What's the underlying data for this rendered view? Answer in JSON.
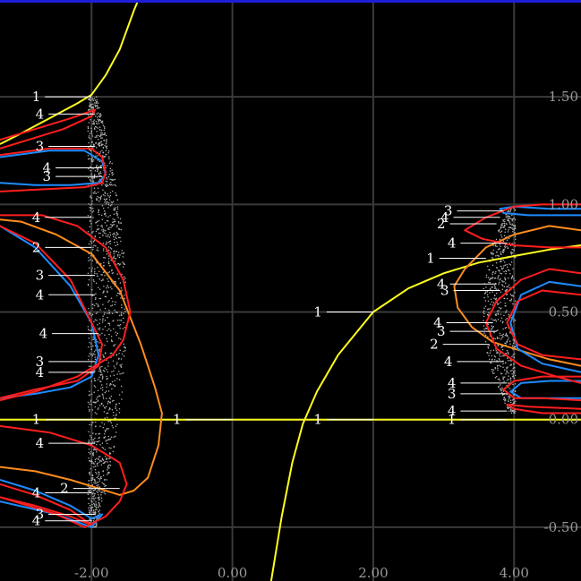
{
  "colors": {
    "background": "#000000",
    "grid": "#3a3a3a",
    "gray_region": "#b4b4b4",
    "c1": "#ffff1e",
    "c2": "#ff8c1e",
    "c3": "#1e8cff",
    "c4": "#ff1e1e",
    "top_border": "#1e1ed8"
  },
  "chart_data": {
    "type": "line",
    "title": "",
    "xlabel": "",
    "ylabel": "",
    "xlim": [
      -3.3,
      4.95
    ],
    "ylim": [
      -0.75,
      1.95
    ],
    "grid": true,
    "x_ticks": [
      {
        "value": -2,
        "label": "-2.00"
      },
      {
        "value": 0,
        "label": "0.00"
      },
      {
        "value": 2,
        "label": "2.00"
      },
      {
        "value": 4,
        "label": "4.00"
      }
    ],
    "y_ticks": [
      {
        "value": -0.5,
        "label": "-0.50"
      },
      {
        "value": 0,
        "label": "0.00"
      },
      {
        "value": 0.5,
        "label": "0.50"
      },
      {
        "value": 1,
        "label": "1.00"
      },
      {
        "value": 1.5,
        "label": "1.50"
      }
    ],
    "series": [
      {
        "period": "1",
        "color": "#ffff1e",
        "segments": [
          [
            [
              -3.3,
              1.28
            ],
            [
              -3.0,
              1.33
            ],
            [
              -2.6,
              1.4
            ],
            [
              -2.2,
              1.47
            ],
            [
              -2.0,
              1.51
            ],
            [
              -1.8,
              1.6
            ],
            [
              -1.6,
              1.72
            ],
            [
              -1.4,
              1.9
            ],
            [
              -1.3,
              1.98
            ]
          ],
          [
            [
              -3.3,
              0.0
            ],
            [
              4.95,
              0.0
            ]
          ],
          [
            [
              0.55,
              -0.75
            ],
            [
              0.7,
              -0.45
            ],
            [
              0.85,
              -0.2
            ],
            [
              1.0,
              -0.02
            ],
            [
              1.2,
              0.13
            ],
            [
              1.5,
              0.3
            ],
            [
              2.0,
              0.5
            ],
            [
              2.5,
              0.61
            ],
            [
              3.0,
              0.68
            ],
            [
              3.5,
              0.73
            ],
            [
              4.0,
              0.76
            ],
            [
              4.5,
              0.79
            ],
            [
              4.95,
              0.81
            ]
          ]
        ]
      },
      {
        "period": "2",
        "color": "#ff8c1e",
        "segments": [
          [
            [
              -3.3,
              0.93
            ],
            [
              -3.0,
              0.92
            ],
            [
              -2.5,
              0.86
            ],
            [
              -2.0,
              0.77
            ],
            [
              -1.6,
              0.6
            ],
            [
              -1.3,
              0.35
            ],
            [
              -1.1,
              0.15
            ],
            [
              -1.0,
              0.03
            ],
            [
              -1.05,
              -0.12
            ],
            [
              -1.2,
              -0.27
            ],
            [
              -1.4,
              -0.33
            ],
            [
              -1.6,
              -0.35
            ],
            [
              -1.9,
              -0.32
            ],
            [
              -2.3,
              -0.28
            ],
            [
              -2.8,
              -0.24
            ],
            [
              -3.3,
              -0.22
            ]
          ],
          [
            [
              4.95,
              0.88
            ],
            [
              4.5,
              0.9
            ],
            [
              4.0,
              0.86
            ],
            [
              3.6,
              0.8
            ],
            [
              3.3,
              0.7
            ],
            [
              3.15,
              0.62
            ],
            [
              3.2,
              0.52
            ],
            [
              3.4,
              0.43
            ],
            [
              3.7,
              0.36
            ],
            [
              4.0,
              0.33
            ],
            [
              4.5,
              0.28
            ],
            [
              4.95,
              0.25
            ]
          ]
        ]
      },
      {
        "period": "3",
        "color": "#1e8cff",
        "segments": [
          [
            [
              -3.3,
              1.22
            ],
            [
              -2.6,
              1.25
            ],
            [
              -2.1,
              1.25
            ],
            [
              -1.85,
              1.2
            ],
            [
              -1.8,
              1.14
            ],
            [
              -1.9,
              1.1
            ],
            [
              -2.3,
              1.09
            ],
            [
              -2.8,
              1.09
            ],
            [
              -3.3,
              1.1
            ]
          ],
          [
            [
              -3.3,
              0.9
            ],
            [
              -2.8,
              0.8
            ],
            [
              -2.3,
              0.62
            ],
            [
              -2.0,
              0.45
            ],
            [
              -1.9,
              0.3
            ],
            [
              -2.0,
              0.2
            ],
            [
              -2.3,
              0.15
            ],
            [
              -2.8,
              0.12
            ],
            [
              -3.3,
              0.1
            ]
          ],
          [
            [
              -3.3,
              -0.28
            ],
            [
              -2.8,
              -0.33
            ],
            [
              -2.3,
              -0.4
            ],
            [
              -2.0,
              -0.46
            ],
            [
              -1.85,
              -0.44
            ],
            [
              -2.0,
              -0.5
            ],
            [
              -2.5,
              -0.44
            ],
            [
              -3.3,
              -0.38
            ]
          ],
          [
            [
              4.95,
              0.98
            ],
            [
              4.5,
              0.98
            ],
            [
              4.0,
              0.99
            ],
            [
              3.8,
              0.98
            ],
            [
              3.85,
              0.96
            ],
            [
              4.2,
              0.95
            ],
            [
              4.95,
              0.95
            ]
          ],
          [
            [
              4.95,
              0.62
            ],
            [
              4.5,
              0.64
            ],
            [
              4.1,
              0.58
            ],
            [
              3.95,
              0.45
            ],
            [
              4.05,
              0.33
            ],
            [
              4.4,
              0.26
            ],
            [
              4.95,
              0.22
            ]
          ],
          [
            [
              4.95,
              0.18
            ],
            [
              4.5,
              0.18
            ],
            [
              4.1,
              0.17
            ],
            [
              3.95,
              0.13
            ],
            [
              4.1,
              0.1
            ],
            [
              4.5,
              0.1
            ],
            [
              4.95,
              0.1
            ]
          ]
        ]
      },
      {
        "period": "4",
        "color": "#ff1e1e",
        "segments": [
          [
            [
              -3.3,
              1.3
            ],
            [
              -2.8,
              1.35
            ],
            [
              -2.3,
              1.4
            ],
            [
              -1.95,
              1.44
            ],
            [
              -2.0,
              1.41
            ],
            [
              -2.4,
              1.35
            ],
            [
              -2.9,
              1.3
            ],
            [
              -3.3,
              1.26
            ]
          ],
          [
            [
              -3.3,
              1.23
            ],
            [
              -2.6,
              1.26
            ],
            [
              -2.0,
              1.26
            ],
            [
              -1.85,
              1.22
            ],
            [
              -1.8,
              1.15
            ],
            [
              -1.85,
              1.1
            ],
            [
              -2.1,
              1.08
            ],
            [
              -2.7,
              1.07
            ],
            [
              -3.3,
              1.06
            ]
          ],
          [
            [
              -3.3,
              0.95
            ],
            [
              -2.7,
              0.95
            ],
            [
              -2.2,
              0.9
            ],
            [
              -1.8,
              0.8
            ],
            [
              -1.55,
              0.65
            ],
            [
              -1.45,
              0.5
            ],
            [
              -1.55,
              0.37
            ],
            [
              -1.7,
              0.3
            ],
            [
              -2.2,
              0.2
            ],
            [
              -2.8,
              0.13
            ],
            [
              -3.3,
              0.09
            ]
          ],
          [
            [
              -3.3,
              0.9
            ],
            [
              -2.8,
              0.82
            ],
            [
              -2.3,
              0.65
            ],
            [
              -2.0,
              0.45
            ],
            [
              -1.85,
              0.35
            ],
            [
              -1.9,
              0.25
            ],
            [
              -2.2,
              0.18
            ],
            [
              -2.8,
              0.14
            ],
            [
              -3.3,
              0.1
            ]
          ],
          [
            [
              -3.3,
              -0.03
            ],
            [
              -2.6,
              -0.06
            ],
            [
              -2.0,
              -0.12
            ],
            [
              -1.6,
              -0.2
            ],
            [
              -1.5,
              -0.3
            ],
            [
              -1.6,
              -0.38
            ],
            [
              -1.8,
              -0.45
            ],
            [
              -2.1,
              -0.5
            ],
            [
              -2.5,
              -0.44
            ],
            [
              -2.9,
              -0.4
            ],
            [
              -3.3,
              -0.36
            ]
          ],
          [
            [
              -3.3,
              -0.3
            ],
            [
              -2.8,
              -0.35
            ],
            [
              -2.3,
              -0.42
            ],
            [
              -2.0,
              -0.49
            ],
            [
              -2.3,
              -0.45
            ],
            [
              -2.8,
              -0.4
            ],
            [
              -3.3,
              -0.36
            ]
          ],
          [
            [
              4.95,
              1.0
            ],
            [
              4.4,
              1.0
            ],
            [
              4.0,
              0.99
            ],
            [
              3.6,
              0.94
            ],
            [
              3.3,
              0.88
            ],
            [
              3.55,
              0.84
            ],
            [
              4.0,
              0.81
            ],
            [
              4.5,
              0.8
            ],
            [
              4.95,
              0.8
            ]
          ],
          [
            [
              4.95,
              0.68
            ],
            [
              4.5,
              0.7
            ],
            [
              4.1,
              0.65
            ],
            [
              3.75,
              0.55
            ],
            [
              3.6,
              0.45
            ],
            [
              3.75,
              0.33
            ],
            [
              4.1,
              0.25
            ],
            [
              4.6,
              0.2
            ],
            [
              4.95,
              0.17
            ]
          ],
          [
            [
              4.95,
              0.58
            ],
            [
              4.4,
              0.6
            ],
            [
              4.05,
              0.55
            ],
            [
              3.9,
              0.45
            ],
            [
              4.05,
              0.35
            ],
            [
              4.4,
              0.3
            ],
            [
              4.95,
              0.28
            ]
          ],
          [
            [
              4.95,
              0.2
            ],
            [
              4.4,
              0.2
            ],
            [
              4.0,
              0.18
            ],
            [
              3.85,
              0.14
            ],
            [
              4.0,
              0.1
            ],
            [
              4.4,
              0.1
            ],
            [
              4.95,
              0.09
            ]
          ],
          [
            [
              4.95,
              0.03
            ],
            [
              4.4,
              0.03
            ],
            [
              4.0,
              0.05
            ],
            [
              3.9,
              0.07
            ],
            [
              4.2,
              0.06
            ],
            [
              4.95,
              0.05
            ]
          ]
        ]
      }
    ],
    "chaotic_regions": [
      {
        "name": "left",
        "x_min": -2.05,
        "x_max": -1.5,
        "y_min": -0.5,
        "y_max": 1.5
      },
      {
        "name": "right",
        "x_min": 3.55,
        "x_max": 4.02,
        "y_min": 0.03,
        "y_max": 0.99
      }
    ],
    "annotations": [
      {
        "text": "1",
        "x": -2.0,
        "y": 1.5,
        "side": "left",
        "color": "#ffff1e"
      },
      {
        "text": "4",
        "x": -1.95,
        "y": 1.42,
        "side": "left",
        "color": "#ff1e1e"
      },
      {
        "text": "3",
        "x": -1.95,
        "y": 1.27,
        "side": "left",
        "color": "#1e8cff"
      },
      {
        "text": "4",
        "x": -1.85,
        "y": 1.17,
        "side": "left",
        "color": "#ff1e1e"
      },
      {
        "text": "3",
        "x": -1.85,
        "y": 1.13,
        "side": "left",
        "color": "#1e8cff"
      },
      {
        "text": "4",
        "x": -2.0,
        "y": 0.94,
        "side": "left",
        "color": "#ff1e1e"
      },
      {
        "text": "2",
        "x": -2.0,
        "y": 0.8,
        "side": "left",
        "color": "#ff8c1e"
      },
      {
        "text": "3",
        "x": -1.95,
        "y": 0.67,
        "side": "left",
        "color": "#1e8cff"
      },
      {
        "text": "4",
        "x": -1.95,
        "y": 0.58,
        "side": "left",
        "color": "#ff1e1e"
      },
      {
        "text": "4",
        "x": -1.9,
        "y": 0.4,
        "side": "left",
        "color": "#ff1e1e"
      },
      {
        "text": "3",
        "x": -1.95,
        "y": 0.27,
        "side": "left",
        "color": "#1e8cff"
      },
      {
        "text": "4",
        "x": -1.95,
        "y": 0.22,
        "side": "left",
        "color": "#ff1e1e"
      },
      {
        "text": "1",
        "x": -2.0,
        "y": 0.0,
        "side": "left",
        "color": "#ffff1e"
      },
      {
        "text": "1",
        "x": 0.0,
        "y": 0.0,
        "side": "left",
        "color": "#ffff1e"
      },
      {
        "text": "1",
        "x": 2.0,
        "y": 0.0,
        "side": "left",
        "color": "#ffff1e"
      },
      {
        "text": "4",
        "x": -1.95,
        "y": -0.11,
        "side": "left",
        "color": "#ff1e1e"
      },
      {
        "text": "2",
        "x": -1.6,
        "y": -0.32,
        "side": "left",
        "color": "#ff8c1e"
      },
      {
        "text": "4",
        "x": -2.0,
        "y": -0.34,
        "side": "left",
        "color": "#ff1e1e"
      },
      {
        "text": "3",
        "x": -1.95,
        "y": -0.44,
        "side": "left",
        "color": "#1e8cff"
      },
      {
        "text": "4",
        "x": -2.0,
        "y": -0.47,
        "side": "left",
        "color": "#ff1e1e"
      },
      {
        "text": "1",
        "x": 2.0,
        "y": 0.5,
        "side": "left",
        "color": "#ffff1e"
      },
      {
        "text": "3",
        "x": 3.85,
        "y": 0.97,
        "side": "left",
        "color": "#1e8cff"
      },
      {
        "text": "4",
        "x": 3.8,
        "y": 0.94,
        "side": "left",
        "color": "#ff1e1e"
      },
      {
        "text": "2",
        "x": 3.75,
        "y": 0.91,
        "side": "left",
        "color": "#ff8c1e"
      },
      {
        "text": "4",
        "x": 3.9,
        "y": 0.82,
        "side": "left",
        "color": "#ff1e1e"
      },
      {
        "text": "1",
        "x": 3.6,
        "y": 0.75,
        "side": "left",
        "color": "#ffff1e"
      },
      {
        "text": "4",
        "x": 3.75,
        "y": 0.63,
        "side": "left",
        "color": "#ff1e1e"
      },
      {
        "text": "3",
        "x": 3.8,
        "y": 0.6,
        "side": "left",
        "color": "#1e8cff"
      },
      {
        "text": "4",
        "x": 3.7,
        "y": 0.45,
        "side": "left",
        "color": "#ff1e1e"
      },
      {
        "text": "3",
        "x": 3.75,
        "y": 0.41,
        "side": "left",
        "color": "#1e8cff"
      },
      {
        "text": "2",
        "x": 3.65,
        "y": 0.35,
        "side": "left",
        "color": "#ff8c1e"
      },
      {
        "text": "4",
        "x": 3.85,
        "y": 0.27,
        "side": "left",
        "color": "#ff1e1e"
      },
      {
        "text": "4",
        "x": 3.9,
        "y": 0.17,
        "side": "left",
        "color": "#ff1e1e"
      },
      {
        "text": "3",
        "x": 3.9,
        "y": 0.12,
        "side": "left",
        "color": "#1e8cff"
      },
      {
        "text": "4",
        "x": 3.9,
        "y": 0.04,
        "side": "left",
        "color": "#ff1e1e"
      },
      {
        "text": "1",
        "x": 3.9,
        "y": 0.0,
        "side": "left",
        "color": "#ffff1e"
      }
    ]
  }
}
